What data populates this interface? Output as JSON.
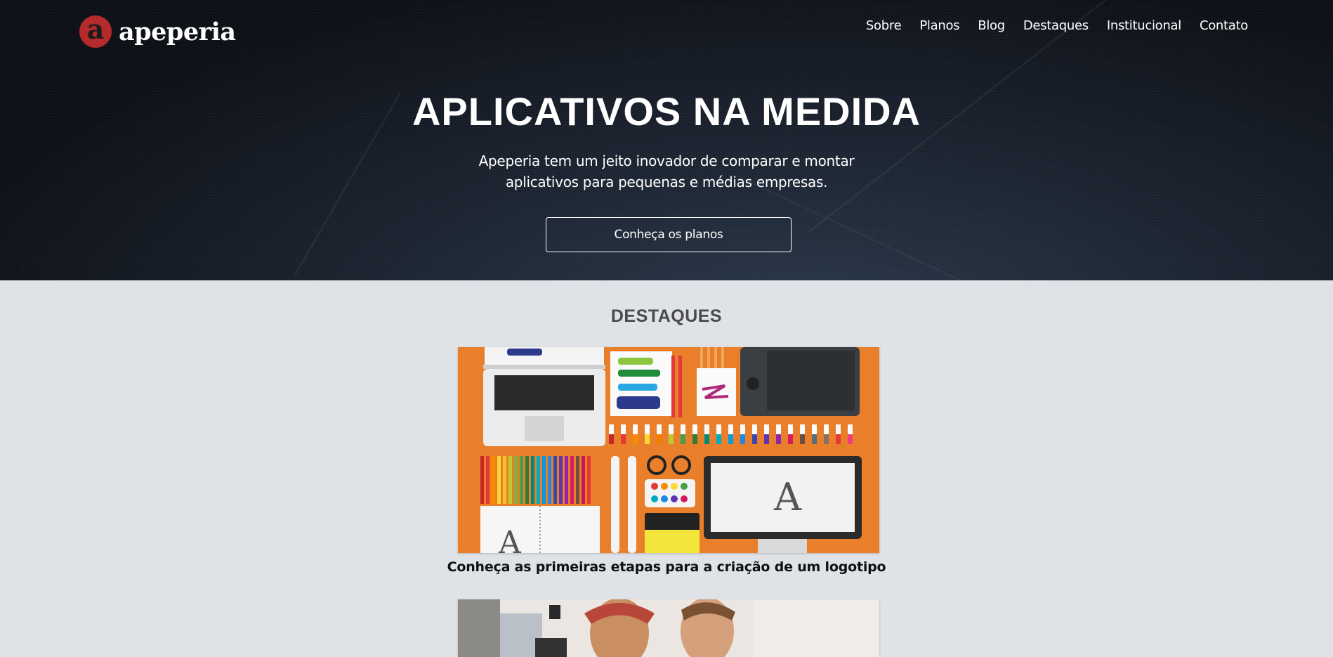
{
  "brand": {
    "mark": "a",
    "name": "apeperia",
    "color": "#b52a2a"
  },
  "nav": [
    "Sobre",
    "Planos",
    "Blog",
    "Destaques",
    "Institucional",
    "Contato"
  ],
  "hero": {
    "title": "APLICATIVOS NA MEDIDA",
    "subtitle_line1": "Apeperia tem um jeito inovador de comparar e montar",
    "subtitle_line2": "aplicativos para pequenas e médias empresas.",
    "button": "Conheça os planos"
  },
  "highlights": {
    "title": "DESTAQUES",
    "items": [
      {
        "caption": "Conheça as primeiras etapas para a criação de um logotipo",
        "image": "designer-desk-illustration"
      },
      {
        "caption": "",
        "image": "people-photo"
      }
    ]
  }
}
